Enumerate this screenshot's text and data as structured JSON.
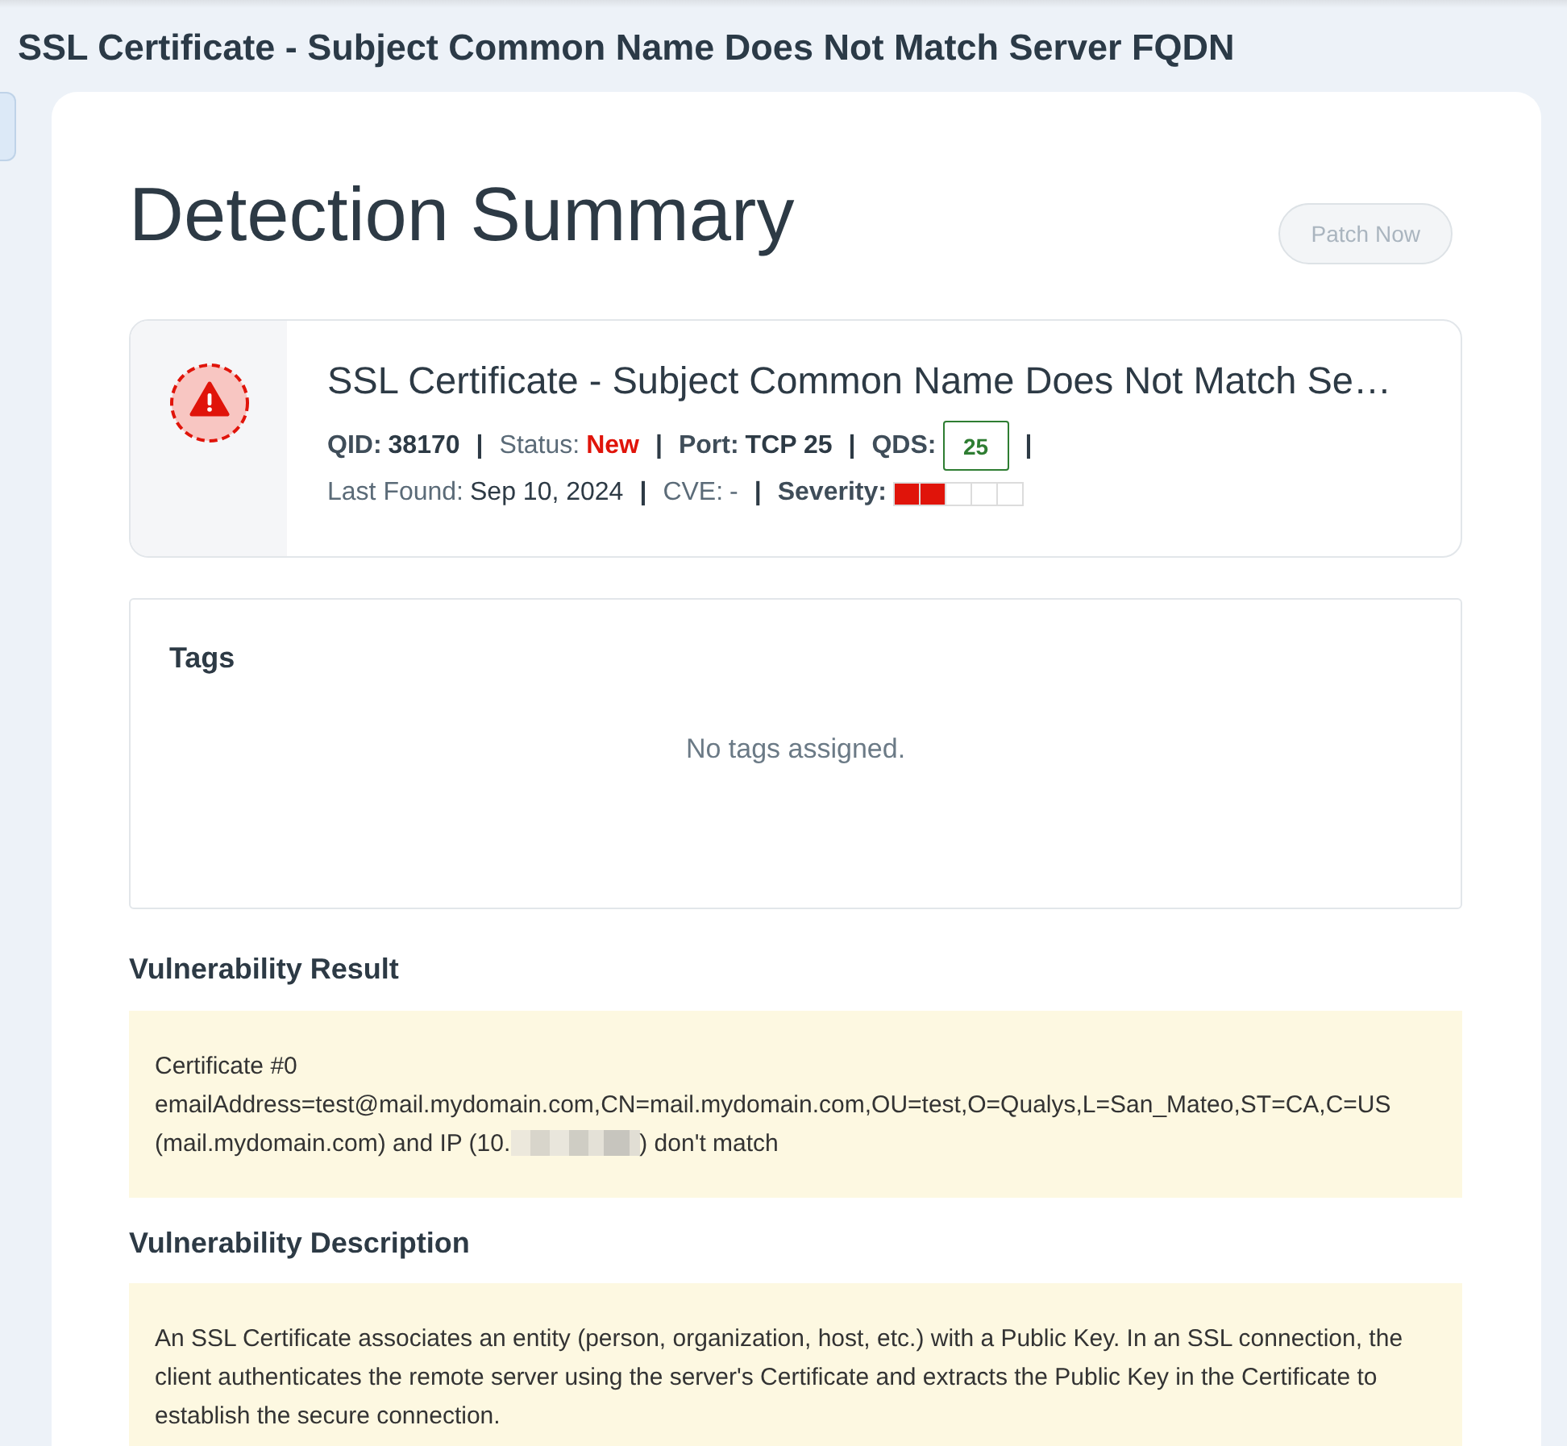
{
  "page_title": "SSL Certificate - Subject Common Name Does Not Match Server FQDN",
  "detection": {
    "heading": "Detection Summary",
    "patch_button": {
      "label": "Patch Now",
      "disabled": true
    },
    "summary": {
      "title": "SSL Certificate - Subject Common Name Does Not Match Se…",
      "lines": [
        {
          "items": [
            {
              "kind": "strong",
              "label": "QID:",
              "value": "38170"
            },
            {
              "kind": "separator",
              "text": "|"
            },
            {
              "kind": "status",
              "label": "Status:",
              "value": "New"
            },
            {
              "kind": "separator",
              "text": "|"
            },
            {
              "kind": "strong",
              "label": "Port:",
              "value": "TCP 25"
            },
            {
              "kind": "separator",
              "text": "|"
            },
            {
              "kind": "score",
              "label": "QDS:",
              "value": "25"
            },
            {
              "kind": "separator",
              "text": "|"
            }
          ]
        },
        {
          "items": [
            {
              "kind": "plain",
              "label": "Last Found:",
              "value": "Sep 10, 2024"
            },
            {
              "kind": "separator",
              "text": "|"
            },
            {
              "kind": "muted",
              "label": "CVE:",
              "value": "-"
            },
            {
              "kind": "separator",
              "text": "|"
            },
            {
              "kind": "rating",
              "label": "Severity:",
              "stars": 2
            }
          ]
        }
      ]
    },
    "tags": {
      "title": "Tags",
      "empty_message": "No tags assigned."
    },
    "sections": [
      {
        "title": "Vulnerability Result",
        "lines": [
          [
            {
              "kind": "text",
              "text": "Certificate #0"
            }
          ],
          [
            {
              "kind": "text",
              "text": "emailAddress=test@mail.mydomain.com,CN=mail.mydomain.com,OU=test,O=Qualys,L=San_Mateo,ST=CA,C=US"
            }
          ],
          [
            {
              "kind": "text",
              "text": "(mail.mydomain.com) and IP (10."
            },
            {
              "kind": "redacted"
            },
            {
              "kind": "text",
              "text": ") don't match"
            }
          ]
        ]
      },
      {
        "title": "Vulnerability Description",
        "lines": [
          [
            {
              "kind": "text",
              "text": "An SSL Certificate associates an entity (person, organization, host, etc.) with a Public Key. In an SSL connection, the client authenticates the remote server using the server's Certificate and extracts the Public Key in the Certificate to establish the secure connection."
            }
          ]
        ]
      }
    ]
  }
}
